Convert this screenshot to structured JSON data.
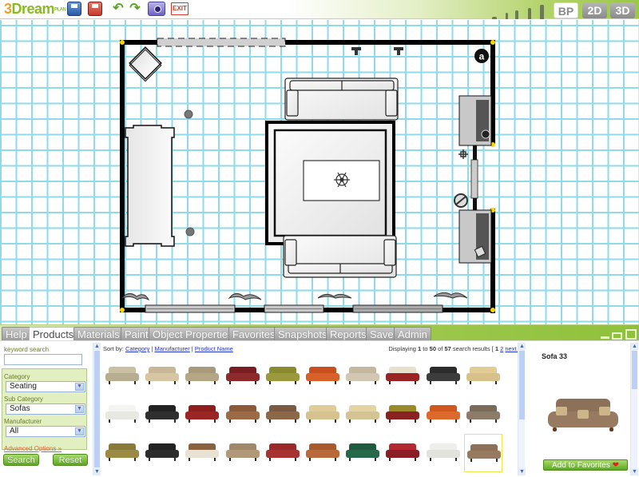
{
  "app": {
    "logo_text": "Dream",
    "logo_sub": "PLAN"
  },
  "toolbar": {
    "icons": [
      "save-icon",
      "save-as-icon",
      "undo-icon",
      "redo-icon",
      "camera-icon",
      "exit-icon"
    ],
    "exit_label": "EXIT",
    "undo_glyph": "↶",
    "redo_glyph": "↷"
  },
  "view_modes": {
    "bp": "BP",
    "two_d": "2D",
    "three_d": "3D",
    "active": "BP"
  },
  "floorplan": {
    "markers": {
      "a_label": "a",
      "b_label": "a"
    }
  },
  "tabs": [
    {
      "label": "Help"
    },
    {
      "label": "Products",
      "active": true
    },
    {
      "label": "Materials"
    },
    {
      "label": "Paint"
    },
    {
      "label": "Object Properties"
    },
    {
      "label": "Favorites"
    },
    {
      "label": "Snapshots"
    },
    {
      "label": "Reports"
    },
    {
      "label": "Save"
    },
    {
      "label": "Admin"
    }
  ],
  "search": {
    "keyword_label": "keyword search",
    "keyword_value": "",
    "category_label": "Category",
    "category_value": "Seating",
    "subcategory_label": "Sub Category",
    "subcategory_value": "Sofas",
    "manufacturer_label": "Manufacturer",
    "manufacturer_value": "All",
    "advanced_link": "Advanced Options »",
    "search_button": "Search",
    "reset_button": "Reset"
  },
  "results": {
    "sort_label": "Sort by:",
    "sort_options": [
      "Category",
      "Manufacturer",
      "Product Name"
    ],
    "paging_prefix": "Displaying",
    "range_start": "1",
    "range_to": "to",
    "range_end": "50",
    "of": "of",
    "total": "57",
    "suffix": "search results [",
    "current_page": "1",
    "next_page": "2",
    "next_label": "next »",
    "close_bracket": "]",
    "items": [
      {
        "back": "#c9c0a4",
        "seat": "#b7ae92"
      },
      {
        "back": "#c8b896",
        "seat": "#d6c6a4"
      },
      {
        "back": "#a89a7a",
        "seat": "#b5a785"
      },
      {
        "back": "#7a1e22",
        "seat": "#8c2a2c"
      },
      {
        "back": "#8a8a2e",
        "seat": "#9a9a3c"
      },
      {
        "back": "#c8501e",
        "seat": "#d8612a"
      },
      {
        "back": "#c4b8a0",
        "seat": "#d2c7b0"
      },
      {
        "back": "#e6e0cc",
        "seat": "#9a2424"
      },
      {
        "back": "#2c2c2c",
        "seat": "#3c3c3c"
      },
      {
        "back": "#e2cc94",
        "seat": "#d8c08a"
      },
      {
        "back": "#f4f4f0",
        "seat": "#e8e8e2"
      },
      {
        "back": "#222222",
        "seat": "#2e2e2e"
      },
      {
        "back": "#8c1e1e",
        "seat": "#9a2626"
      },
      {
        "back": "#8a5a3a",
        "seat": "#9c6a46"
      },
      {
        "back": "#7a5a40",
        "seat": "#8c6848"
      },
      {
        "back": "#e0cc98",
        "seat": "#d6c28e"
      },
      {
        "back": "#e4d4a4",
        "seat": "#d4c494"
      },
      {
        "back": "#9a8a2a",
        "seat": "#8a2222"
      },
      {
        "back": "#d0581e",
        "seat": "#dc6a2c"
      },
      {
        "back": "#7a6a5a",
        "seat": "#8c7c68"
      },
      {
        "back": "#8a7a3a",
        "seat": "#9a8a44"
      },
      {
        "back": "#222222",
        "seat": "#2c2c2c"
      },
      {
        "back": "#8a6240",
        "seat": "#e8e2d4"
      },
      {
        "back": "#a08868",
        "seat": "#b09878"
      },
      {
        "back": "#9a2a2a",
        "seat": "#a83232"
      },
      {
        "back": "#a85a2c",
        "seat": "#b86a3a"
      },
      {
        "back": "#1e5a3e",
        "seat": "#26684a"
      },
      {
        "back": "#b42832",
        "seat": "#8a1e26"
      },
      {
        "back": "#eeeeea",
        "seat": "#e2e2dc"
      },
      {
        "back": "#8c7058",
        "seat": "#977a60",
        "selected": true
      }
    ]
  },
  "details": {
    "title": "Sofa 33",
    "favorites_button": "Add to Favorites",
    "heart": "❤"
  }
}
